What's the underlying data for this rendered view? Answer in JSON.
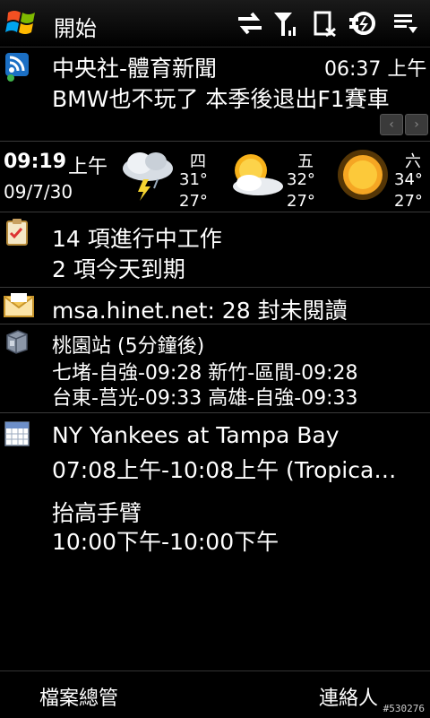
{
  "topbar": {
    "start_label": "開始",
    "icons": [
      "data-sync-icon",
      "signal-strength-icon",
      "volume-mute-icon",
      "battery-charging-icon",
      "menu-icon"
    ]
  },
  "news": {
    "source": "中央社-體育新聞",
    "time": "06:37 上午",
    "headline": "BMW也不玩了 本季後退出F1賽車",
    "prev": "‹",
    "next": "›"
  },
  "clock": {
    "time": "09:19",
    "ampm": "上午",
    "date": "09/7/30"
  },
  "weather": [
    {
      "day": "四",
      "high": "31°",
      "low": "27°",
      "icon": "thunderstorm-icon"
    },
    {
      "day": "五",
      "high": "32°",
      "low": "27°",
      "icon": "partly-cloudy-icon"
    },
    {
      "day": "六",
      "high": "34°",
      "low": "27°",
      "icon": "sunny-icon"
    }
  ],
  "tasks": {
    "line1": "14 項進行中工作",
    "line2": "2 項今天到期"
  },
  "mail": {
    "text": "msa.hinet.net: 28 封未閱讀"
  },
  "train": {
    "title": "桃園站 (5分鐘後)",
    "row1": "七堵-自強-09:28   新竹-區間-09:28",
    "row2": "台東-莒光-09:33   高雄-自強-09:33"
  },
  "calendar": {
    "event1_title": "NY Yankees at Tampa Bay",
    "event1_time": "07:08上午-10:08上午 (Tropica…",
    "event2_title": "抬高手臂",
    "event2_time": "10:00下午-10:00下午"
  },
  "softkeys": {
    "left": "檔案總管",
    "right": "連絡人"
  },
  "watermark": "#530276"
}
